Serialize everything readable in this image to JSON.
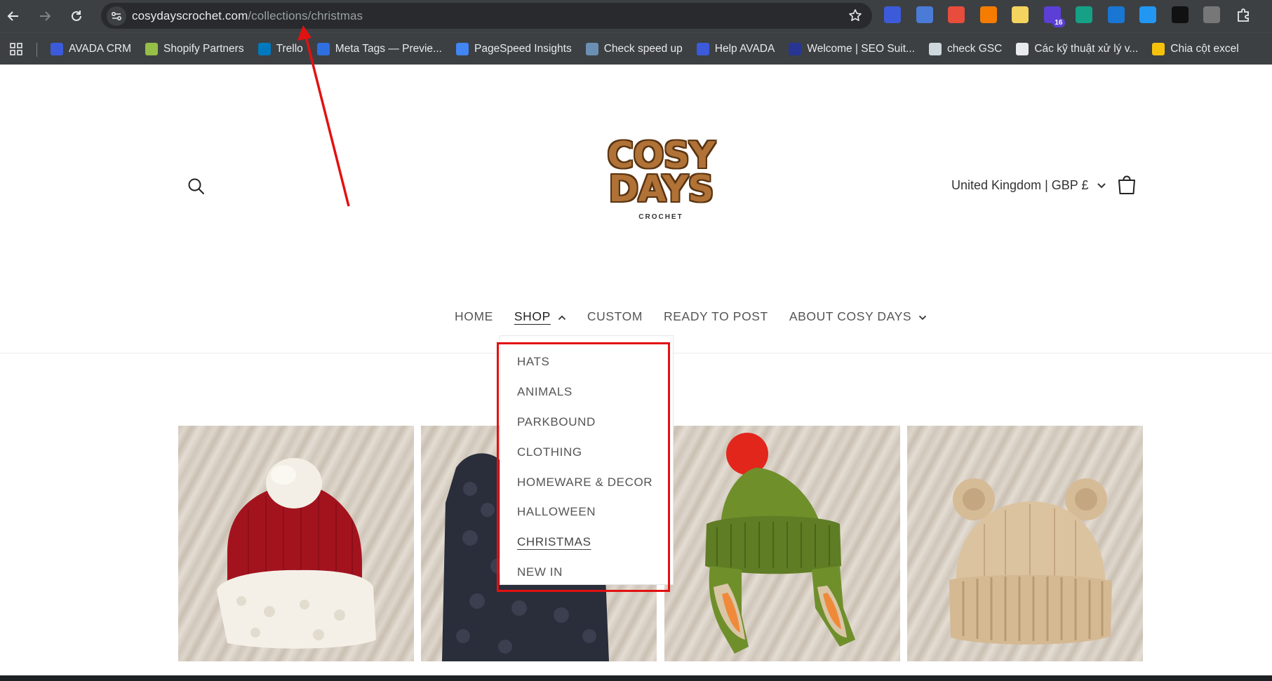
{
  "browser": {
    "url_domain": "cosydayscrochet.com",
    "url_path": "/collections/christmas",
    "extensions": [
      {
        "icon": "avada-icon",
        "color": "#3b5bdb"
      },
      {
        "icon": "google-translate-icon",
        "color": "#4a7bd6"
      },
      {
        "icon": "color-wheel-icon",
        "color": "#e74c3c"
      },
      {
        "icon": "fire-icon",
        "color": "#f57c00"
      },
      {
        "icon": "notes-icon",
        "color": "#f4d35e"
      },
      {
        "icon": "graduation-cap-icon",
        "color": "#5b3fd6",
        "badge": "16"
      },
      {
        "icon": "ring-icon",
        "color": "#16a085"
      },
      {
        "icon": "b-icon",
        "color": "#1976d2"
      },
      {
        "icon": "network-icon",
        "color": "#2196f3"
      },
      {
        "icon": "magnifier-icon",
        "color": "#111111"
      },
      {
        "icon": "code-icon",
        "color": "#777777"
      },
      {
        "icon": "puzzle-icon",
        "color": "#e8eaed"
      }
    ]
  },
  "bookmarks": [
    {
      "label": "AVADA CRM",
      "icon": "avada-icon",
      "color": "#3b5bdb"
    },
    {
      "label": "Shopify Partners",
      "icon": "shopify-icon",
      "color": "#95bf47"
    },
    {
      "label": "Trello",
      "icon": "trello-icon",
      "color": "#0079bf"
    },
    {
      "label": "Meta Tags — Previe...",
      "icon": "meta-tags-icon",
      "color": "#2f6fdf"
    },
    {
      "label": "PageSpeed Insights",
      "icon": "pagespeed-icon",
      "color": "#4285f4"
    },
    {
      "label": "Check speed up",
      "icon": "gtmetrix-icon",
      "color": "#6b8fb3"
    },
    {
      "label": "Help AVADA",
      "icon": "avada-icon",
      "color": "#3b5bdb"
    },
    {
      "label": "Welcome | SEO Suit...",
      "icon": "seo-suite-icon",
      "color": "#283593"
    },
    {
      "label": "check GSC",
      "icon": "store-icon",
      "color": "#cfd8dc"
    },
    {
      "label": "Các kỹ thuật xử lý v...",
      "icon": "globe-icon",
      "color": "#e8eaed"
    },
    {
      "label": "Chia cột excel",
      "icon": "excel-icon",
      "color": "#f4c20d"
    }
  ],
  "store": {
    "logo_line1": "COSY",
    "logo_line2": "DAYS",
    "logo_sub": "CROCHET",
    "country_selector": "United Kingdom | GBP £",
    "menu": [
      {
        "label": "HOME",
        "active": false,
        "chevron": false
      },
      {
        "label": "SHOP",
        "active": true,
        "chevron": "up"
      },
      {
        "label": "CUSTOM",
        "active": false,
        "chevron": false
      },
      {
        "label": "READY TO POST",
        "active": false,
        "chevron": false
      },
      {
        "label": "ABOUT COSY DAYS",
        "active": false,
        "chevron": "down"
      }
    ],
    "shop_dropdown": [
      "HATS",
      "ANIMALS",
      "PARKBOUND",
      "CLOTHING",
      "HOMEWARE & DECOR",
      "HALLOWEEN",
      "CHRISTMAS",
      "NEW IN"
    ],
    "current_collection": "CHRISTMAS"
  },
  "products": [
    {
      "image": "red-santa-hat-with-white-pompom"
    },
    {
      "image": "dark-navy-crochet-item"
    },
    {
      "image": "green-earflap-hat-with-red-pompom"
    },
    {
      "image": "beige-bear-ear-hat"
    }
  ],
  "annotations": {
    "highlight_color": "#e21111"
  }
}
